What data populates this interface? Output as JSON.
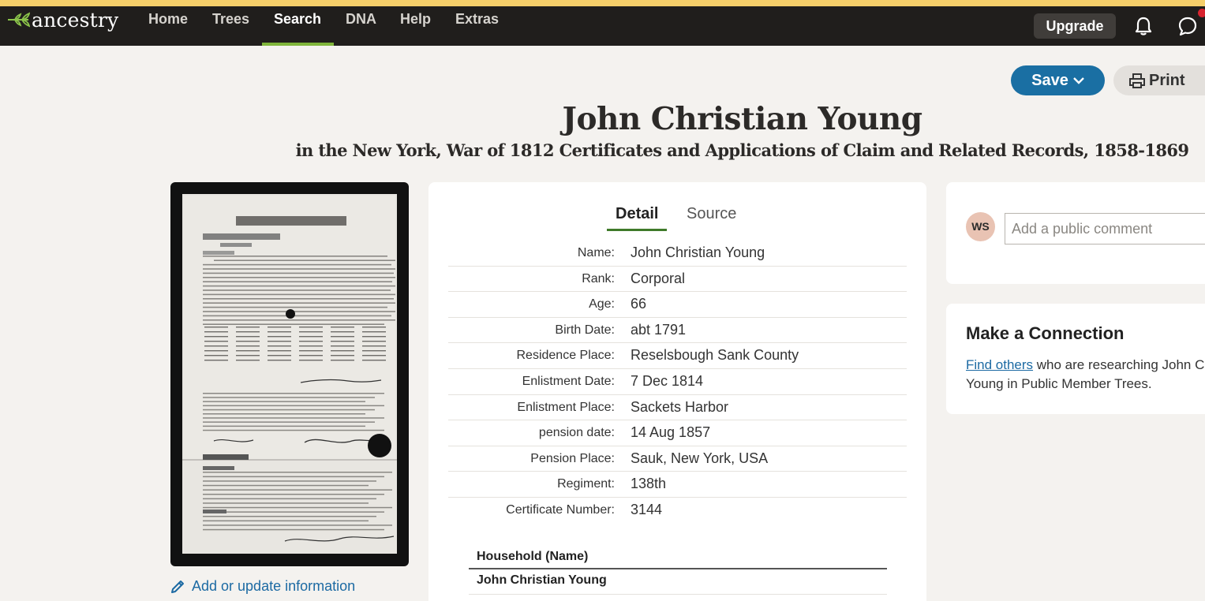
{
  "nav": {
    "logo_text": "ancestry",
    "items": [
      {
        "label": "Home"
      },
      {
        "label": "Trees"
      },
      {
        "label": "Search"
      },
      {
        "label": "DNA"
      },
      {
        "label": "Help"
      },
      {
        "label": "Extras"
      }
    ],
    "active_item": "Search",
    "upgrade_label": "Upgrade",
    "icons": [
      "leaf-logo-icon",
      "bell-icon",
      "chat-icon"
    ]
  },
  "actions": {
    "save_label": "Save",
    "print_label": "Print"
  },
  "record": {
    "name": "John Christian Young",
    "collection": "in the New York, War of 1812 Certificates and Applications of Claim and Related Records, 1858-1869"
  },
  "image": {
    "add_info_label": "Add or update information"
  },
  "tabs": {
    "detail": "Detail",
    "source": "Source",
    "active": "Detail"
  },
  "facts": [
    {
      "label": "Name:",
      "value": "John Christian Young"
    },
    {
      "label": "Rank:",
      "value": "Corporal"
    },
    {
      "label": "Age:",
      "value": "66"
    },
    {
      "label": "Birth Date:",
      "value": "abt 1791"
    },
    {
      "label": "Residence Place:",
      "value": "Reselsbough Sank County"
    },
    {
      "label": "Enlistment Date:",
      "value": "7 Dec 1814"
    },
    {
      "label": "Enlistment Place:",
      "value": "Sackets Harbor"
    },
    {
      "label": "pension date:",
      "value": "14 Aug 1857"
    },
    {
      "label": "Pension Place:",
      "value": "Sauk, New York, USA"
    },
    {
      "label": "Regiment:",
      "value": "138th"
    },
    {
      "label": "Certificate Number:",
      "value": "3144"
    }
  ],
  "household": {
    "header": "Household (Name)",
    "rows": [
      "John Christian Young"
    ]
  },
  "comment": {
    "avatar_initials": "WS",
    "placeholder": "Add a public comment"
  },
  "connection": {
    "title": "Make a Connection",
    "link_text": "Find others",
    "text_after_link": " who are researching John Christian",
    "text_line2": "Young in Public Member Trees."
  },
  "colors": {
    "nav_background": "#201e1c",
    "top_stripe": "#f5cf6a",
    "active_tab_underline": "#7fb53a",
    "save_button": "#1a6fa3",
    "link": "#1c6aa3",
    "page_background": "#f4f2ef"
  }
}
